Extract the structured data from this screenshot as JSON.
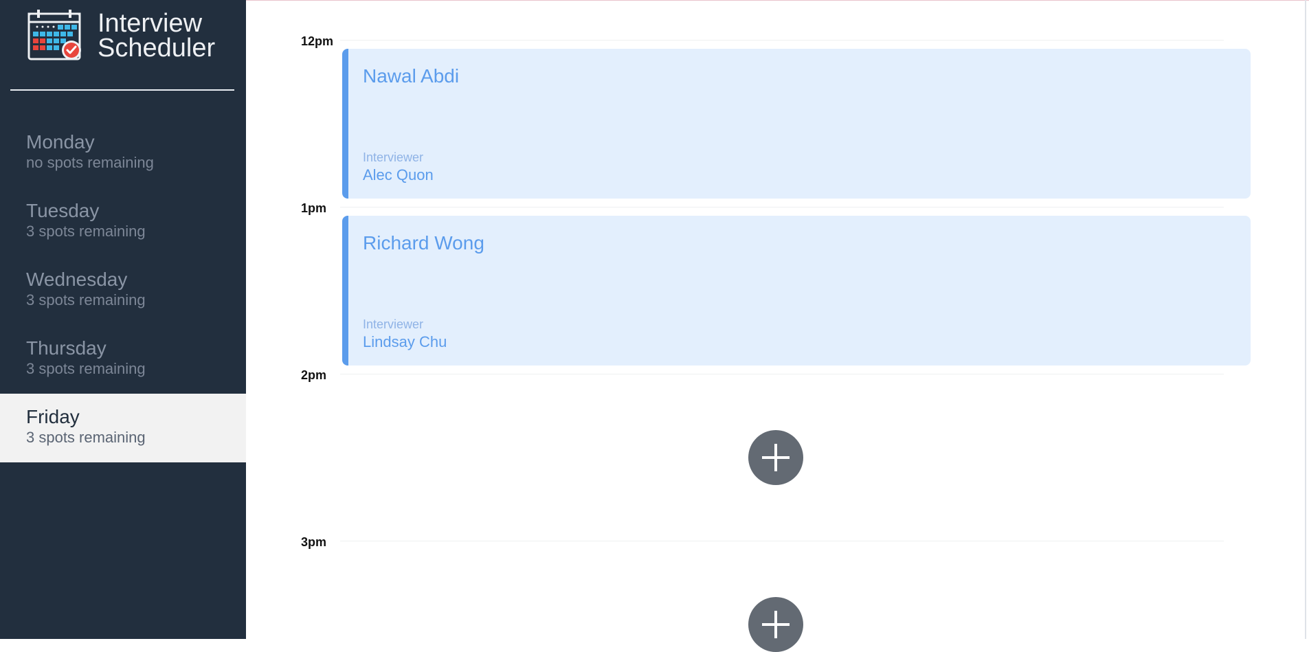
{
  "app": {
    "title_line1": "Interview",
    "title_line2": "Scheduler",
    "logo_icon": "calendar-check-icon"
  },
  "days": [
    {
      "name": "Monday",
      "spots": "no spots remaining",
      "selected": false
    },
    {
      "name": "Tuesday",
      "spots": "3 spots remaining",
      "selected": false
    },
    {
      "name": "Wednesday",
      "spots": "3 spots remaining",
      "selected": false
    },
    {
      "name": "Thursday",
      "spots": "3 spots remaining",
      "selected": false
    },
    {
      "name": "Friday",
      "spots": "3 spots remaining",
      "selected": true
    }
  ],
  "schedule": {
    "hours": [
      "12pm",
      "1pm",
      "2pm",
      "3pm"
    ],
    "appointments": [
      {
        "time": "12pm",
        "student": "Nawal Abdi",
        "interviewer_label": "Interviewer",
        "interviewer": "Alec Quon"
      },
      {
        "time": "1pm",
        "student": "Richard Wong",
        "interviewer_label": "Interviewer",
        "interviewer": "Lindsay Chu"
      }
    ],
    "add_icon": "plus-icon"
  },
  "colors": {
    "sidebar_bg": "#222f3e",
    "selected_day_bg": "#f2f2f2",
    "appointment_bg": "#e3effd",
    "appointment_accent": "#5b9cec",
    "add_button_bg": "#636a73"
  }
}
